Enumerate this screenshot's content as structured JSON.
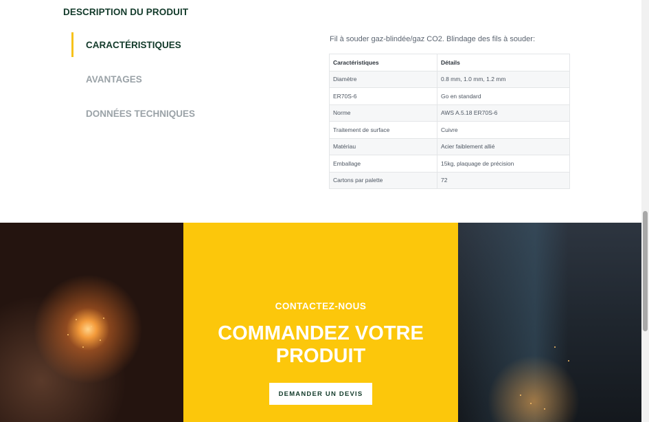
{
  "section": {
    "title": "DESCRIPTION DU PRODUIT"
  },
  "tabs": [
    {
      "label": "CARACTÉRISTIQUES",
      "active": true
    },
    {
      "label": "AVANTAGES",
      "active": false
    },
    {
      "label": "DONNÉES TECHNIQUES",
      "active": false
    }
  ],
  "specs": {
    "intro": "Fil à souder gaz-blindée/gaz CO2. Blindage des fils à souder:",
    "headers": [
      "Caractéristiques",
      "Détails"
    ],
    "rows": [
      [
        "Diamètre",
        "0.8 mm, 1.0 mm, 1.2 mm"
      ],
      [
        "ER70S-6",
        "Go en standard"
      ],
      [
        "Norme",
        "AWS A.5.18 ER70S-6"
      ],
      [
        "Traitement de surface",
        "Cuivre"
      ],
      [
        "Matériau",
        "Acier faiblement allié"
      ],
      [
        "Emballage",
        "15kg, plaquage de précision"
      ],
      [
        "Cartons par palette",
        "72"
      ]
    ]
  },
  "cta": {
    "kicker": "CONTACTEZ-NOUS",
    "title_line1": "COMMANDEZ VOTRE",
    "title_line2": "PRODUIT",
    "button_label": "DEMANDER UN DEVIS"
  },
  "colors": {
    "accent": "#fcc70b",
    "brand_dark": "#123a2a",
    "tab_inactive": "#9aa2a7"
  }
}
